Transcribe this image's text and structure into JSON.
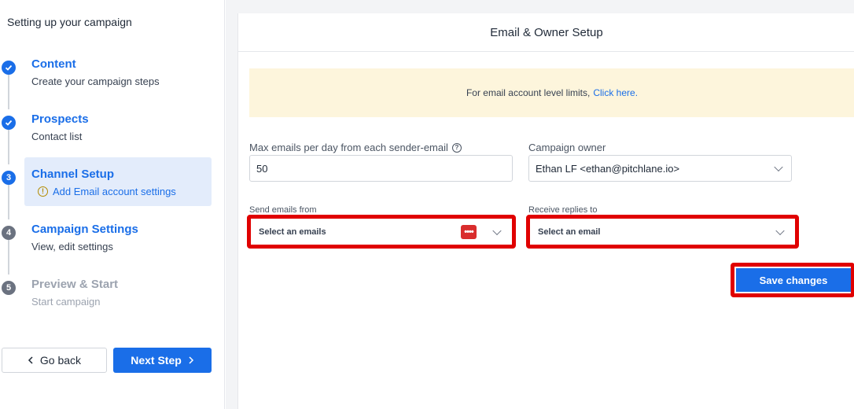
{
  "sidebar": {
    "title": "Setting up your campaign",
    "steps": [
      {
        "number": "1",
        "title": "Content",
        "subtitle": "Create your campaign steps",
        "status": "done"
      },
      {
        "number": "2",
        "title": "Prospects",
        "subtitle": "Contact list",
        "status": "done"
      },
      {
        "number": "3",
        "title": "Channel Setup",
        "subtitle": "Add Email account settings",
        "status": "current"
      },
      {
        "number": "4",
        "title": "Campaign Settings",
        "subtitle": "View, edit settings",
        "status": "pending"
      },
      {
        "number": "5",
        "title": "Preview & Start",
        "subtitle": "Start campaign",
        "status": "disabled"
      }
    ],
    "back_label": "Go back",
    "next_label": "Next Step"
  },
  "main": {
    "header_title": "Email & Owner Setup",
    "banner": {
      "text": "For email account level limits,",
      "link_text": "Click here."
    },
    "max_emails": {
      "label": "Max emails per day from each sender-email",
      "value": "50"
    },
    "campaign_owner": {
      "label": "Campaign owner",
      "value": "Ethan LF <ethan@pitchlane.io>"
    },
    "send_from": {
      "label": "Send emails from",
      "placeholder": "Select an emails",
      "badge": "••••"
    },
    "receive_replies": {
      "label": "Receive replies to",
      "placeholder": "Select an email"
    },
    "save_label": "Save changes"
  },
  "colors": {
    "primary": "#1a6ee8",
    "highlight": "#e00000",
    "banner_bg": "#fdf5dc",
    "active_step_bg": "#e3ecfb"
  },
  "icons": {
    "done": "check-icon",
    "warning": "warning-circle-icon",
    "help": "question-circle-icon",
    "chevron": "chevron-down-icon"
  }
}
